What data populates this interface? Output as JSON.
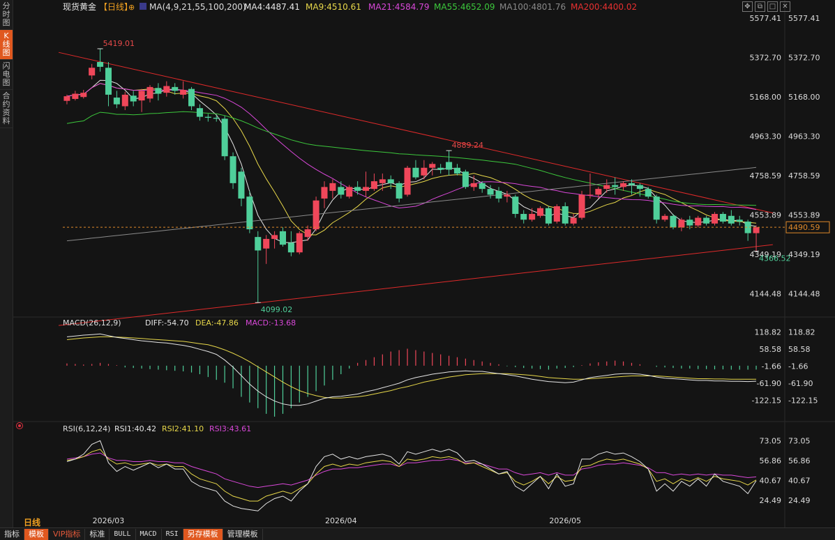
{
  "sidebar": {
    "items": [
      {
        "label": "分时图",
        "active": false
      },
      {
        "label": "K线图",
        "active": true
      },
      {
        "label": "闪电图",
        "active": false
      },
      {
        "label": "合约资料",
        "active": false
      }
    ]
  },
  "header": {
    "symbol": "现货黄金",
    "period": "【日线】",
    "ma_params": "MA(4,9,21,55,100,200)",
    "ma_labels": [
      {
        "text": "MA4:4487.41",
        "color": "#e6e6e6"
      },
      {
        "text": "MA9:4510.61",
        "color": "#e8d84a"
      },
      {
        "text": "MA21:4584.79",
        "color": "#d948d9"
      },
      {
        "text": "MA55:4652.09",
        "color": "#3cc83c"
      },
      {
        "text": "MA100:4801.76",
        "color": "#8a8a8a"
      },
      {
        "text": "MA200:4400.02",
        "color": "#e83030"
      }
    ]
  },
  "period_label": "日线",
  "toolbar": {
    "buttons": [
      "指标",
      "模板",
      "VIP指标",
      "标准",
      "BULL",
      "MACD",
      "RSI",
      "另存模板",
      "管理模板"
    ]
  },
  "colors": {
    "up": "#f0475a",
    "down": "#4fcf9a",
    "background": "#141414",
    "grid": "#2e2e2e"
  },
  "chart_data": [
    {
      "type": "candlestick",
      "title": "现货黄金 日线",
      "y_ticks": [
        "5577.41",
        "5372.70",
        "5168.00",
        "4963.30",
        "4758.59",
        "4553.89",
        "4349.19",
        "4144.48"
      ],
      "ylim": [
        4060,
        5600
      ],
      "x_labels": [
        {
          "text": "2026/03",
          "candle_index": 5
        },
        {
          "text": "2026/04",
          "candle_index": 33
        },
        {
          "text": "2026/05",
          "candle_index": 60
        }
      ],
      "last_price": "4490.59",
      "annotations": [
        {
          "text": "5419.01",
          "candle_index": 4,
          "value": 5419.01,
          "kind": "high"
        },
        {
          "text": "4889.24",
          "candle_index": 46,
          "value": 4889.24,
          "kind": "high"
        },
        {
          "text": "4099.02",
          "candle_index": 23,
          "value": 4099.02,
          "kind": "low"
        },
        {
          "text": "4366.52",
          "candle_index": 83,
          "value": 4366.52,
          "kind": "low"
        }
      ],
      "candles": [
        [
          5148,
          5172,
          5130,
          5180
        ],
        [
          5158,
          5185,
          5150,
          5200
        ],
        [
          5168,
          5190,
          5160,
          5205
        ],
        [
          5280,
          5320,
          5260,
          5340
        ],
        [
          5350,
          5325,
          5300,
          5419.01
        ],
        [
          5320,
          5180,
          5120,
          5350
        ],
        [
          5165,
          5130,
          5110,
          5200
        ],
        [
          5120,
          5180,
          5100,
          5195
        ],
        [
          5175,
          5145,
          5120,
          5200
        ],
        [
          5150,
          5200,
          5090,
          5210
        ],
        [
          5160,
          5220,
          5140,
          5230
        ],
        [
          5215,
          5185,
          5150,
          5240
        ],
        [
          5190,
          5225,
          5170,
          5250
        ],
        [
          5220,
          5200,
          5180,
          5240
        ],
        [
          5180,
          5205,
          5160,
          5250
        ],
        [
          5210,
          5120,
          5100,
          5220
        ],
        [
          5110,
          5065,
          5045,
          5130
        ],
        [
          5065,
          5060,
          5040,
          5080
        ],
        [
          5060,
          5055,
          5040,
          5075
        ],
        [
          5055,
          4860,
          4840,
          5070
        ],
        [
          4860,
          4720,
          4690,
          4880
        ],
        [
          4780,
          4640,
          4600,
          4800
        ],
        [
          4650,
          4480,
          4460,
          4680
        ],
        [
          4440,
          4370,
          4099.02,
          4470
        ],
        [
          4380,
          4430,
          4300,
          4450
        ],
        [
          4430,
          4450,
          4380,
          4470
        ],
        [
          4470,
          4400,
          4390,
          4490
        ],
        [
          4410,
          4360,
          4340,
          4470
        ],
        [
          4360,
          4460,
          4350,
          4470
        ],
        [
          4440,
          4480,
          4420,
          4500
        ],
        [
          4480,
          4630,
          4470,
          4650
        ],
        [
          4640,
          4700,
          4590,
          4730
        ],
        [
          4680,
          4720,
          4640,
          4740
        ],
        [
          4700,
          4660,
          4640,
          4730
        ],
        [
          4650,
          4700,
          4640,
          4710
        ],
        [
          4700,
          4680,
          4660,
          4730
        ],
        [
          4680,
          4700,
          4650,
          4780
        ],
        [
          4690,
          4730,
          4680,
          4770
        ],
        [
          4720,
          4740,
          4680,
          4770
        ],
        [
          4740,
          4720,
          4690,
          4760
        ],
        [
          4720,
          4640,
          4620,
          4730
        ],
        [
          4660,
          4800,
          4650,
          4810
        ],
        [
          4800,
          4750,
          4740,
          4840
        ],
        [
          4760,
          4800,
          4740,
          4840
        ],
        [
          4800,
          4820,
          4760,
          4830
        ],
        [
          4800,
          4790,
          4770,
          4820
        ],
        [
          4830,
          4790,
          4760,
          4889.24
        ],
        [
          4800,
          4770,
          4760,
          4820
        ],
        [
          4780,
          4700,
          4690,
          4790
        ],
        [
          4700,
          4720,
          4680,
          4760
        ],
        [
          4720,
          4690,
          4670,
          4730
        ],
        [
          4690,
          4660,
          4640,
          4710
        ],
        [
          4680,
          4640,
          4620,
          4700
        ],
        [
          4650,
          4660,
          4620,
          4680
        ],
        [
          4650,
          4560,
          4540,
          4660
        ],
        [
          4560,
          4530,
          4510,
          4580
        ],
        [
          4530,
          4560,
          4520,
          4590
        ],
        [
          4550,
          4590,
          4540,
          4600
        ],
        [
          4590,
          4510,
          4500,
          4600
        ],
        [
          4520,
          4600,
          4510,
          4610
        ],
        [
          4600,
          4510,
          4500,
          4620
        ],
        [
          4510,
          4540,
          4500,
          4560
        ],
        [
          4540,
          4660,
          4530,
          4680
        ],
        [
          4660,
          4660,
          4640,
          4770
        ],
        [
          4660,
          4690,
          4640,
          4700
        ],
        [
          4690,
          4710,
          4670,
          4740
        ],
        [
          4710,
          4700,
          4660,
          4750
        ],
        [
          4700,
          4720,
          4680,
          4730
        ],
        [
          4720,
          4710,
          4660,
          4740
        ],
        [
          4710,
          4690,
          4650,
          4720
        ],
        [
          4690,
          4650,
          4640,
          4700
        ],
        [
          4650,
          4530,
          4510,
          4660
        ],
        [
          4530,
          4550,
          4520,
          4560
        ],
        [
          4550,
          4490,
          4480,
          4560
        ],
        [
          4490,
          4530,
          4470,
          4540
        ],
        [
          4530,
          4500,
          4480,
          4550
        ],
        [
          4500,
          4540,
          4490,
          4550
        ],
        [
          4540,
          4510,
          4500,
          4550
        ],
        [
          4510,
          4560,
          4500,
          4570
        ],
        [
          4560,
          4520,
          4510,
          4570
        ],
        [
          4550,
          4510,
          4500,
          4580
        ],
        [
          4530,
          4520,
          4500,
          4550
        ],
        [
          4520,
          4460,
          4420,
          4530
        ],
        [
          4460,
          4490.59,
          4366.52,
          4500
        ]
      ],
      "candle_format": "[open, close, low, high]",
      "moving_averages": [
        {
          "name": "MA4",
          "color": "#e6e6e6",
          "width": 1.0
        },
        {
          "name": "MA9",
          "color": "#e8d84a",
          "width": 1.0
        },
        {
          "name": "MA21",
          "color": "#d948d9",
          "width": 1.0
        },
        {
          "name": "MA55",
          "color": "#3cc83c",
          "width": 1.0
        },
        {
          "name": "MA100",
          "color": "#8a8a8a",
          "width": 1.0
        },
        {
          "name": "MA200",
          "color": "#e83030",
          "width": 1.0
        }
      ],
      "trendlines": [
        {
          "from": {
            "candle_index": -1,
            "value": 5400
          },
          "to": {
            "candle_index": 85,
            "value": 4565
          },
          "color": "#e02a2a"
        },
        {
          "from": {
            "candle_index": -1,
            "value": 3980
          },
          "to": {
            "candle_index": 85,
            "value": 4400
          },
          "color": "#e02a2a"
        }
      ]
    },
    {
      "type": "macd",
      "title": "MACD(26,12,9)",
      "labels": [
        {
          "text": "MACD(26,12,9)",
          "color": "#dddddd"
        },
        {
          "text": "DIFF:-54.70",
          "color": "#e6e6e6"
        },
        {
          "text": "DEA:-47.86",
          "color": "#e8d84a"
        },
        {
          "text": "MACD:-13.68",
          "color": "#d948d9"
        }
      ],
      "y_ticks": [
        "118.82",
        "58.58",
        "-1.66",
        "-61.90",
        "-122.15"
      ],
      "ylim": [
        -185,
        135
      ],
      "diff": [
        102,
        105,
        108,
        110,
        112,
        106,
        100,
        96,
        92,
        88,
        85,
        82,
        80,
        76,
        72,
        66,
        58,
        50,
        40,
        20,
        -5,
        -35,
        -65,
        -90,
        -110,
        -125,
        -135,
        -140,
        -140,
        -135,
        -125,
        -115,
        -110,
        -108,
        -104,
        -100,
        -92,
        -86,
        -78,
        -70,
        -62,
        -50,
        -42,
        -36,
        -30,
        -26,
        -22,
        -20,
        -18,
        -20,
        -20,
        -24,
        -28,
        -32,
        -36,
        -42,
        -48,
        -52,
        -56,
        -58,
        -60,
        -58,
        -50,
        -42,
        -38,
        -34,
        -30,
        -28,
        -28,
        -30,
        -34,
        -40,
        -44,
        -46,
        -48,
        -50,
        -52,
        -52,
        -54,
        -54,
        -55,
        -55,
        -56,
        -54.7
      ],
      "dea": [
        92,
        95,
        98,
        100,
        102,
        102,
        101,
        100,
        98,
        96,
        94,
        92,
        90,
        88,
        86,
        82,
        78,
        74,
        66,
        56,
        44,
        30,
        14,
        -4,
        -22,
        -40,
        -58,
        -74,
        -88,
        -98,
        -106,
        -112,
        -114,
        -114,
        -112,
        -110,
        -106,
        -100,
        -94,
        -88,
        -80,
        -74,
        -66,
        -58,
        -52,
        -46,
        -40,
        -36,
        -32,
        -30,
        -28,
        -28,
        -28,
        -28,
        -30,
        -32,
        -34,
        -38,
        -42,
        -44,
        -46,
        -48,
        -48,
        -46,
        -44,
        -42,
        -40,
        -38,
        -36,
        -36,
        -36,
        -36,
        -38,
        -40,
        -42,
        -44,
        -46,
        -46,
        -47,
        -47,
        -48,
        -48,
        -48,
        -47.86
      ],
      "hist": [
        8,
        6,
        4,
        6,
        10,
        6,
        2,
        -6,
        -8,
        -10,
        -12,
        -14,
        -16,
        -18,
        -20,
        -24,
        -30,
        -40,
        -50,
        -60,
        -80,
        -110,
        -130,
        -150,
        -170,
        -180,
        -170,
        -150,
        -130,
        -110,
        -90,
        -70,
        -50,
        -30,
        -10,
        10,
        20,
        30,
        40,
        50,
        55,
        60,
        55,
        50,
        45,
        40,
        35,
        30,
        25,
        20,
        15,
        10,
        5,
        -2,
        -5,
        -8,
        -10,
        -12,
        -14,
        -10,
        -8,
        -5,
        2,
        8,
        12,
        15,
        18,
        15,
        10,
        5,
        0,
        -4,
        -6,
        -8,
        -10,
        -10,
        -12,
        -12,
        -13,
        -13,
        -14,
        -14,
        -14,
        -13.68
      ]
    },
    {
      "type": "rsi",
      "title": "RSI(6,12,24)",
      "labels": [
        {
          "text": "RSI(6,12,24)",
          "color": "#dddddd"
        },
        {
          "text": "RSI1:40.42",
          "color": "#e6e6e6"
        },
        {
          "text": "RSI2:41.10",
          "color": "#e8d84a"
        },
        {
          "text": "RSI3:43.61",
          "color": "#d948d9"
        }
      ],
      "y_ticks": [
        "73.05",
        "56.86",
        "40.67",
        "24.49"
      ],
      "ylim": [
        15,
        80
      ],
      "rsi1": [
        56,
        58,
        62,
        70,
        73,
        55,
        48,
        52,
        49,
        52,
        55,
        51,
        54,
        50,
        50,
        40,
        36,
        34,
        32,
        24,
        20,
        18,
        17,
        16,
        22,
        26,
        28,
        24,
        32,
        38,
        52,
        60,
        62,
        58,
        60,
        58,
        60,
        61,
        62,
        60,
        54,
        64,
        62,
        64,
        66,
        64,
        66,
        63,
        56,
        57,
        54,
        50,
        46,
        48,
        36,
        32,
        38,
        44,
        34,
        46,
        36,
        38,
        58,
        58,
        62,
        64,
        62,
        63,
        60,
        56,
        50,
        32,
        38,
        32,
        40,
        36,
        42,
        36,
        46,
        40,
        38,
        36,
        30,
        40.42
      ],
      "rsi2": [
        57,
        58,
        60,
        64,
        66,
        58,
        54,
        55,
        53,
        54,
        55,
        53,
        54,
        52,
        52,
        46,
        42,
        40,
        38,
        32,
        28,
        26,
        24,
        24,
        28,
        30,
        32,
        30,
        34,
        38,
        46,
        52,
        54,
        52,
        54,
        53,
        55,
        56,
        57,
        56,
        52,
        58,
        57,
        58,
        60,
        59,
        60,
        58,
        54,
        55,
        52,
        49,
        46,
        47,
        40,
        37,
        40,
        44,
        38,
        44,
        40,
        41,
        52,
        53,
        56,
        58,
        57,
        58,
        56,
        54,
        50,
        40,
        42,
        38,
        42,
        40,
        43,
        40,
        44,
        42,
        41,
        40,
        37,
        41.1
      ],
      "rsi3": [
        58,
        59,
        60,
        62,
        63,
        59,
        57,
        57,
        56,
        56,
        57,
        56,
        56,
        55,
        55,
        52,
        50,
        48,
        46,
        42,
        40,
        38,
        36,
        35,
        36,
        37,
        38,
        37,
        39,
        41,
        45,
        48,
        50,
        50,
        51,
        51,
        52,
        53,
        54,
        54,
        52,
        55,
        55,
        56,
        57,
        57,
        58,
        57,
        55,
        55,
        54,
        52,
        50,
        50,
        47,
        45,
        46,
        47,
        45,
        47,
        45,
        45,
        50,
        51,
        53,
        54,
        54,
        55,
        54,
        53,
        51,
        47,
        47,
        45,
        46,
        45,
        46,
        45,
        46,
        45,
        45,
        44,
        43,
        43.61
      ]
    }
  ]
}
